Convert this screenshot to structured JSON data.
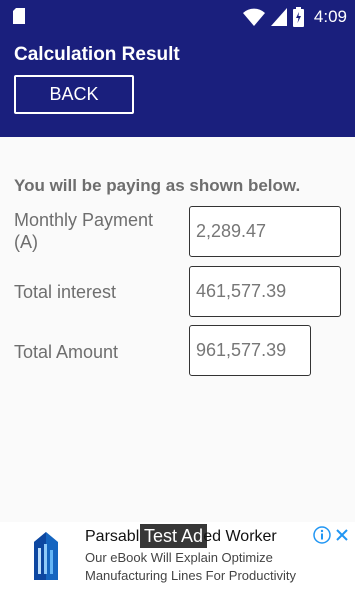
{
  "status_bar": {
    "time": "4:09",
    "icons": [
      "sd-card-icon",
      "wifi-icon",
      "signal-icon",
      "battery-charging-icon"
    ]
  },
  "app_bar": {
    "title": "Calculation Result",
    "back_label": "BACK"
  },
  "content": {
    "heading": "You will be paying as shown below.",
    "rows": [
      {
        "label_line1": "Monthly Payment",
        "label_line2": "(A)",
        "value": "2,289.47"
      },
      {
        "label_line1": "Total interest",
        "label_line2": "",
        "value": "461,577.39"
      },
      {
        "label_line1": "Total Amount",
        "label_line2": "",
        "value": "961,577.39"
      }
    ]
  },
  "ad": {
    "badge": "Test Ad",
    "title_left": "Parsabl",
    "title_right": "ed Worker",
    "line1": "Our eBook Will Explain Optimize",
    "line2": "Manufacturing Lines For Productivity",
    "icons": [
      "ad-logo-icon",
      "info-icon",
      "close-icon"
    ]
  },
  "colors": {
    "app_bar": "#1a1f7d",
    "text_gray": "#6e6e6e",
    "logo_blue": "#1565c0"
  }
}
